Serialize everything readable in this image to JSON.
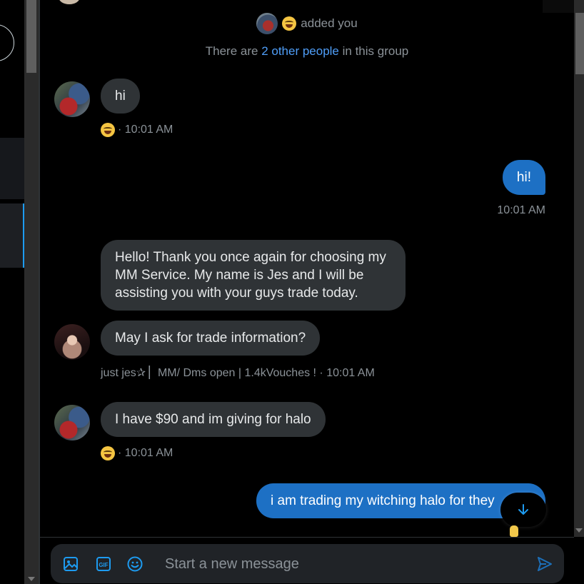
{
  "conversation": {
    "system_added": "added you",
    "group_info": {
      "prefix": "There are ",
      "link": "2 other people",
      "suffix": " in this group"
    },
    "messages": [
      {
        "sender": "user",
        "direction": "in",
        "text": "hi",
        "meta": "· 10:01 AM",
        "reaction": "joy-emoji"
      },
      {
        "sender": "self",
        "direction": "out",
        "text": "hi!",
        "meta": "10:01 AM"
      },
      {
        "sender": "jes",
        "direction": "in",
        "text": "Hello! Thank you once again for choosing my MM Service. My name is Jes and I will be assisting you with your guys trade today."
      },
      {
        "sender": "jes",
        "direction": "in",
        "text": "May I ask for trade information?",
        "meta": "just jes✰ ▏MM/ Dms open | 1.4kVouches ! · 10:01 AM"
      },
      {
        "sender": "user",
        "direction": "in",
        "text": "I have $90 and im giving for halo",
        "meta": "· 10:01 AM",
        "reaction": "joy-emoji"
      },
      {
        "sender": "self",
        "direction": "out",
        "text": "i am trading my witching halo for they"
      }
    ]
  },
  "composer": {
    "placeholder": "Start a new message",
    "gif_label": "GIF"
  },
  "colors": {
    "accent": "#1d9bf0",
    "outgoing_bubble": "#1d70c4",
    "incoming_bubble": "#2f3336",
    "link": "#4f9ef8",
    "muted_text": "#8b9298"
  }
}
